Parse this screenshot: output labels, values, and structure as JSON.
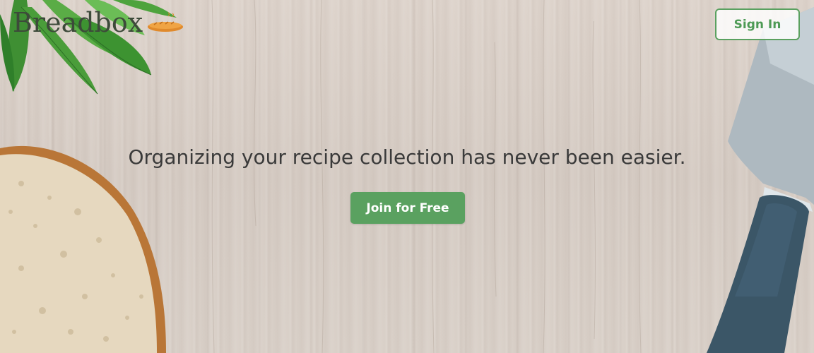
{
  "header": {
    "brand": "Breadbox",
    "sign_in_label": "Sign In"
  },
  "hero": {
    "tagline": "Organizing your recipe collection has never been easier.",
    "cta_label": "Join for Free"
  },
  "colors": {
    "accent": "#5aa160",
    "text": "#3a3a3a",
    "wood": "#d6ccc4"
  },
  "icons": {
    "logo_icon": "bread-loaf-icon"
  }
}
